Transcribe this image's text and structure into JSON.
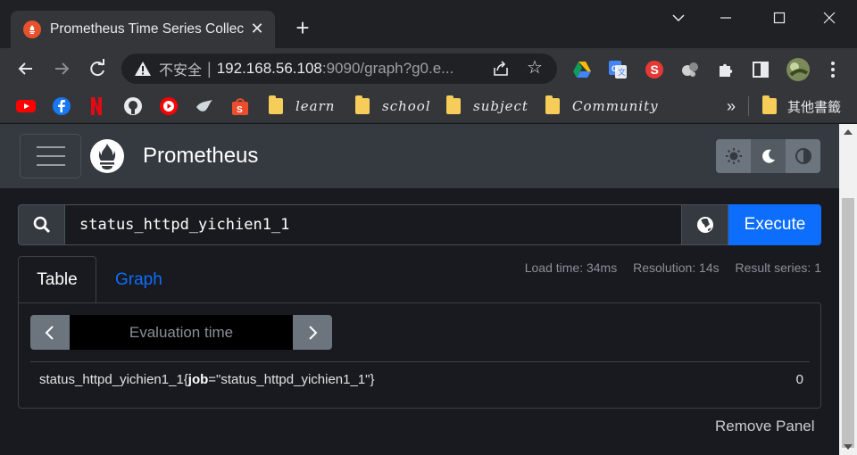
{
  "browser": {
    "tab_title": "Prometheus Time Series Collec",
    "close_glyph": "✕",
    "new_tab_glyph": "+",
    "insecure_label": "不安全",
    "url_host": "192.168.56.108",
    "url_rest": ":9090/graph?g0.e...",
    "bookmarks": [
      {
        "label": "learn"
      },
      {
        "label": "school"
      },
      {
        "label": "subject"
      },
      {
        "label": "Community"
      }
    ],
    "more_bookmarks": "»",
    "other_bookmarks": "其他書籤"
  },
  "app": {
    "brand": "Prometheus",
    "query": "status_httpd_yichien1_1",
    "execute_label": "Execute",
    "tabs": [
      {
        "label": "Table"
      },
      {
        "label": "Graph"
      }
    ],
    "stats": {
      "load_time": "Load time: 34ms",
      "resolution": "Resolution: 14s",
      "result_series": "Result series: 1"
    },
    "eval_placeholder": "Evaluation time",
    "result": {
      "metric": "status_httpd_yichien1_1{",
      "label_key": "job",
      "label_eq": "=\"status_httpd_yichien1_1\"}",
      "value": "0"
    },
    "remove_panel": "Remove Panel"
  },
  "colors": {
    "accent": "#0d6efd",
    "brand_orange": "#e6522c",
    "navbar": "#343a40"
  }
}
